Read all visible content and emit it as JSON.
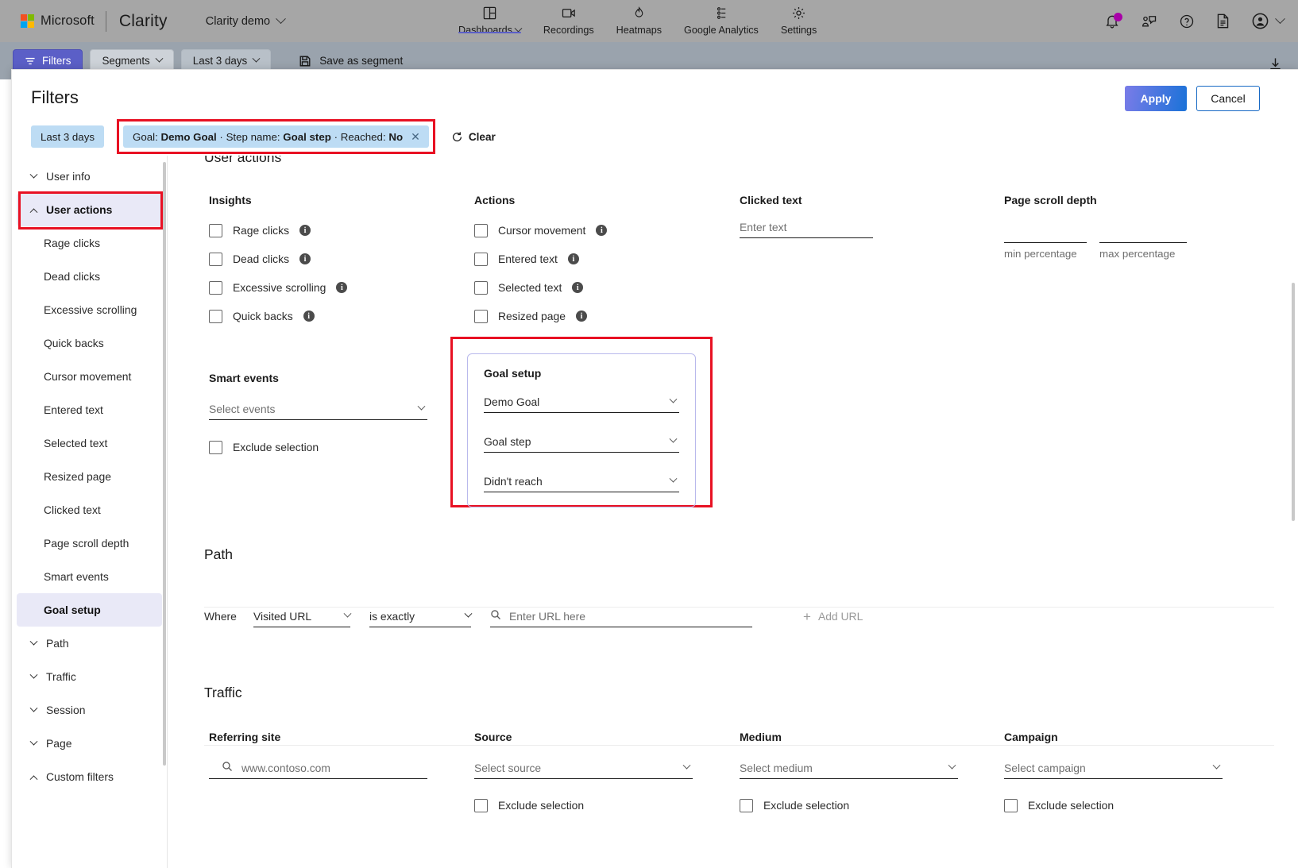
{
  "topbar": {
    "microsoft": "Microsoft",
    "brand": "Clarity",
    "project": "Clarity demo",
    "nav": [
      {
        "label": "Dashboards",
        "icon": "dashboards-icon",
        "caret": true,
        "active": true
      },
      {
        "label": "Recordings",
        "icon": "recordings-icon",
        "caret": false,
        "active": false
      },
      {
        "label": "Heatmaps",
        "icon": "heatmaps-icon",
        "caret": false,
        "active": false
      },
      {
        "label": "Google Analytics",
        "icon": "google-analytics-icon",
        "caret": false,
        "active": false
      },
      {
        "label": "Settings",
        "icon": "settings-gear-icon",
        "caret": false,
        "active": false
      }
    ],
    "right_icons": [
      "notifications-bell-icon",
      "feedback-icon",
      "help-question-icon",
      "documentation-icon",
      "account-avatar-icon"
    ],
    "notification_dot_color": "#a800a8"
  },
  "filterbar": {
    "filters_label": "Filters",
    "segments_label": "Segments",
    "date_label": "Last 3 days",
    "save_segment_label": "Save as segment",
    "download_icon": "download-icon"
  },
  "panel": {
    "title": "Filters",
    "apply_label": "Apply",
    "cancel_label": "Cancel",
    "chip_date": "Last 3 days",
    "chip_goal": {
      "goal_prefix": "Goal:",
      "goal_value": "Demo Goal",
      "sep1": "·",
      "step_prefix": "Step name:",
      "step_value": "Goal step",
      "sep2": "·",
      "reached_prefix": "Reached:",
      "reached_value": "No",
      "close": "✕"
    },
    "clear_label": "Clear"
  },
  "sidebar": {
    "items": [
      {
        "label": "User info",
        "type": "group",
        "state": "collapsed",
        "selected": false
      },
      {
        "label": "User actions",
        "type": "group",
        "state": "expanded",
        "selected": true
      },
      {
        "label": "Rage clicks",
        "type": "child",
        "selected": false
      },
      {
        "label": "Dead clicks",
        "type": "child",
        "selected": false
      },
      {
        "label": "Excessive scrolling",
        "type": "child",
        "selected": false
      },
      {
        "label": "Quick backs",
        "type": "child",
        "selected": false
      },
      {
        "label": "Cursor movement",
        "type": "child",
        "selected": false
      },
      {
        "label": "Entered text",
        "type": "child",
        "selected": false
      },
      {
        "label": "Selected text",
        "type": "child",
        "selected": false
      },
      {
        "label": "Resized page",
        "type": "child",
        "selected": false
      },
      {
        "label": "Clicked text",
        "type": "child",
        "selected": false
      },
      {
        "label": "Page scroll depth",
        "type": "child",
        "selected": false
      },
      {
        "label": "Smart events",
        "type": "child",
        "selected": false
      },
      {
        "label": "Goal setup",
        "type": "child",
        "selected": true
      },
      {
        "label": "Path",
        "type": "group",
        "state": "collapsed",
        "selected": false
      },
      {
        "label": "Traffic",
        "type": "group",
        "state": "collapsed",
        "selected": false
      },
      {
        "label": "Session",
        "type": "group",
        "state": "collapsed",
        "selected": false
      },
      {
        "label": "Page",
        "type": "group",
        "state": "collapsed",
        "selected": false
      },
      {
        "label": "Custom filters",
        "type": "group",
        "state": "expanded",
        "selected": false
      }
    ]
  },
  "user_actions": {
    "section_title": "User actions",
    "insights": {
      "title": "Insights",
      "items": [
        {
          "label": "Rage clicks",
          "checked": false,
          "info": true
        },
        {
          "label": "Dead clicks",
          "checked": false,
          "info": true
        },
        {
          "label": "Excessive scrolling",
          "checked": false,
          "info": true
        },
        {
          "label": "Quick backs",
          "checked": false,
          "info": true
        }
      ]
    },
    "actions": {
      "title": "Actions",
      "items": [
        {
          "label": "Cursor movement",
          "checked": false,
          "info": true
        },
        {
          "label": "Entered text",
          "checked": false,
          "info": true
        },
        {
          "label": "Selected text",
          "checked": false,
          "info": true
        },
        {
          "label": "Resized page",
          "checked": false,
          "info": true
        }
      ]
    },
    "clicked_text": {
      "title": "Clicked text",
      "placeholder": "Enter text",
      "value": ""
    },
    "page_scroll_depth": {
      "title": "Page scroll depth",
      "min_label": "min percentage",
      "max_label": "max percentage",
      "min_value": "",
      "max_value": ""
    },
    "smart_events": {
      "title": "Smart events",
      "select_placeholder": "Select events",
      "exclude_label": "Exclude selection",
      "exclude_checked": false
    },
    "goal_setup": {
      "title": "Goal setup",
      "goal_value": "Demo Goal",
      "step_value": "Goal step",
      "reached_value": "Didn't reach"
    }
  },
  "path": {
    "section_title": "Path",
    "where_label": "Where",
    "field_value": "Visited URL",
    "operator_value": "is exactly",
    "url_placeholder": "Enter URL here",
    "url_value": "",
    "add_url_label": "Add URL"
  },
  "traffic": {
    "section_title": "Traffic",
    "referring_site": {
      "title": "Referring site",
      "placeholder": "www.contoso.com",
      "value": ""
    },
    "source": {
      "title": "Source",
      "placeholder": "Select source",
      "exclude_label": "Exclude selection",
      "exclude_checked": false
    },
    "medium": {
      "title": "Medium",
      "placeholder": "Select medium",
      "exclude_label": "Exclude selection",
      "exclude_checked": false
    },
    "campaign": {
      "title": "Campaign",
      "placeholder": "Select campaign",
      "exclude_label": "Exclude selection",
      "exclude_checked": false
    }
  },
  "colors": {
    "accent": "#5b5fc7",
    "highlight_box": "#e81123",
    "chip_bg": "#bddcf4",
    "selected_nav_bg": "#e9e9f7"
  }
}
